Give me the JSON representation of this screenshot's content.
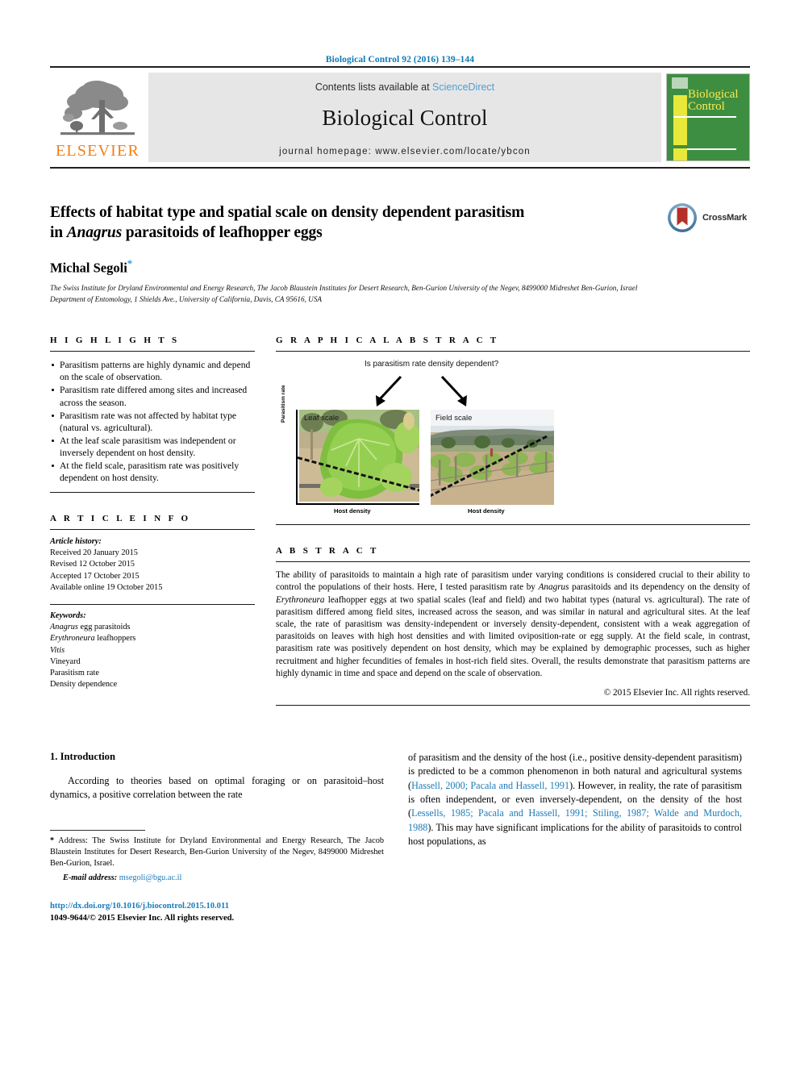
{
  "running_head": "Biological Control 92 (2016) 139–144",
  "masthead": {
    "contents_prefix": "Contents lists available at ",
    "sciencedirect": "ScienceDirect",
    "journal_title": "Biological Control",
    "homepage": "journal homepage: www.elsevier.com/locate/ybcon",
    "publisher_word": "ELSEVIER",
    "cover_title_line1": "Biological",
    "cover_title_line2": "Control",
    "colors": {
      "link_blue": "#4c9fd4",
      "running_head_blue": "#0b7ab5",
      "elsevier_orange": "#f07f1a",
      "cover_green": "#3e8e41",
      "cover_yellow": "#e8e83a"
    }
  },
  "article": {
    "title_line1": "Effects of habitat type and spatial scale on density dependent parasitism",
    "title_line2_pre": "in ",
    "title_line2_ital": "Anagrus",
    "title_line2_post": " parasitoids of leafhopper eggs",
    "author": "Michal Segoli",
    "author_marker": "*",
    "affiliation_1": "The Swiss Institute for Dryland Environmental and Energy Research, The Jacob Blaustein Institutes for Desert Research, Ben-Gurion University of the Negev, 8499000 Midreshet Ben-Gurion, Israel",
    "affiliation_2": "Department of Entomology, 1 Shields Ave., University of California, Davis, CA 95616, USA",
    "crossmark_label": "CrossMark"
  },
  "highlights": {
    "heading": "H I G H L I G H T S",
    "items": [
      "Parasitism patterns are highly dynamic and depend on the scale of observation.",
      "Parasitism rate differed among sites and increased across the season.",
      "Parasitism rate was not affected by habitat type (natural vs. agricultural).",
      "At the leaf scale parasitism was independent or inversely dependent on host density.",
      "At the field scale, parasitism rate was positively dependent on host density."
    ]
  },
  "article_info": {
    "heading": "A R T I C L E    I N F O",
    "history_label": "Article history:",
    "history": [
      "Received 20 January 2015",
      "Revised 12 October 2015",
      "Accepted 17 October 2015",
      "Available online 19 October 2015"
    ],
    "keywords_label": "Keywords:",
    "keywords": [
      {
        "ital": "Anagrus",
        "rest": " egg parasitoids"
      },
      {
        "ital": "Erythroneura",
        "rest": " leafhoppers"
      },
      {
        "ital": "Vitis",
        "rest": ""
      },
      {
        "ital": "",
        "rest": "Vineyard"
      },
      {
        "ital": "",
        "rest": "Parasitism rate"
      },
      {
        "ital": "",
        "rest": "Density dependence"
      }
    ]
  },
  "graphical_abstract": {
    "heading": "G R A P H I C A L   A B S T R A C T",
    "question": "Is parasitism rate density dependent?",
    "y_axis_label": "Parasitism rate",
    "panels": [
      {
        "label": "Leaf scale",
        "x_axis_label": "Host density",
        "trend": "negative"
      },
      {
        "label": "Field scale",
        "x_axis_label": "Host density",
        "trend": "positive"
      }
    ]
  },
  "abstract": {
    "heading": "A B S T R A C T",
    "paragraph_parts": [
      {
        "t": "The ability of parasitoids to maintain a high rate of parasitism under varying conditions is considered crucial to their ability to control the populations of their hosts. Here, I tested parasitism rate by ",
        "i": false
      },
      {
        "t": "Anagrus",
        "i": true
      },
      {
        "t": " parasitoids and its dependency on the density of ",
        "i": false
      },
      {
        "t": "Erythroneura",
        "i": true
      },
      {
        "t": " leafhopper eggs at two spatial scales (leaf and field) and two habitat types (natural vs. agricultural). The rate of parasitism differed among field sites, increased across the season, and was similar in natural and agricultural sites. At the leaf scale, the rate of parasitism was density-independent or inversely density-dependent, consistent with a weak aggregation of parasitoids on leaves with high host densities and with limited oviposition-rate or egg supply. At the field scale, in contrast, parasitism rate was positively dependent on host density, which may be explained by demographic processes, such as higher recruitment and higher fecundities of females in host-rich field sites. Overall, the results demonstrate that parasitism patterns are highly dynamic in time and space and depend on the scale of observation.",
        "i": false
      }
    ],
    "copyright": "© 2015 Elsevier Inc. All rights reserved."
  },
  "intro": {
    "heading": "1. Introduction",
    "left_paragraph": "According to theories based on optimal foraging or on parasitoid–host dynamics, a positive correlation between the rate",
    "right_parts": [
      {
        "t": "of parasitism and the density of the host (i.e., positive density-dependent parasitism) is predicted to be a common phenomenon in both natural and agricultural systems (",
        "link": false
      },
      {
        "t": "Hassell, 2000; Pacala and Hassell, 1991",
        "link": true
      },
      {
        "t": "). However, in reality, the rate of parasitism is often independent, or even inversely-dependent, on the density of the host (",
        "link": false
      },
      {
        "t": "Lessells, 1985; Pacala and Hassell, 1991; Stiling, 1987; Walde and Murdoch, 1988",
        "link": true
      },
      {
        "t": "). This may have significant implications for the ability of parasitoids to control host populations, as",
        "link": false
      }
    ]
  },
  "footer": {
    "footnote_marker": "*",
    "footnote_text": " Address: The Swiss Institute for Dryland Environmental and Energy Research, The Jacob Blaustein Institutes for Desert Research, Ben-Gurion University of the Negev, 8499000 Midreshet Ben-Gurion, Israel.",
    "email_label": "E-mail address:",
    "email": "msegoli@bgu.ac.il",
    "doi": "http://dx.doi.org/10.1016/j.biocontrol.2015.10.011",
    "issn_line": "1049-9644/© 2015 Elsevier Inc. All rights reserved."
  }
}
